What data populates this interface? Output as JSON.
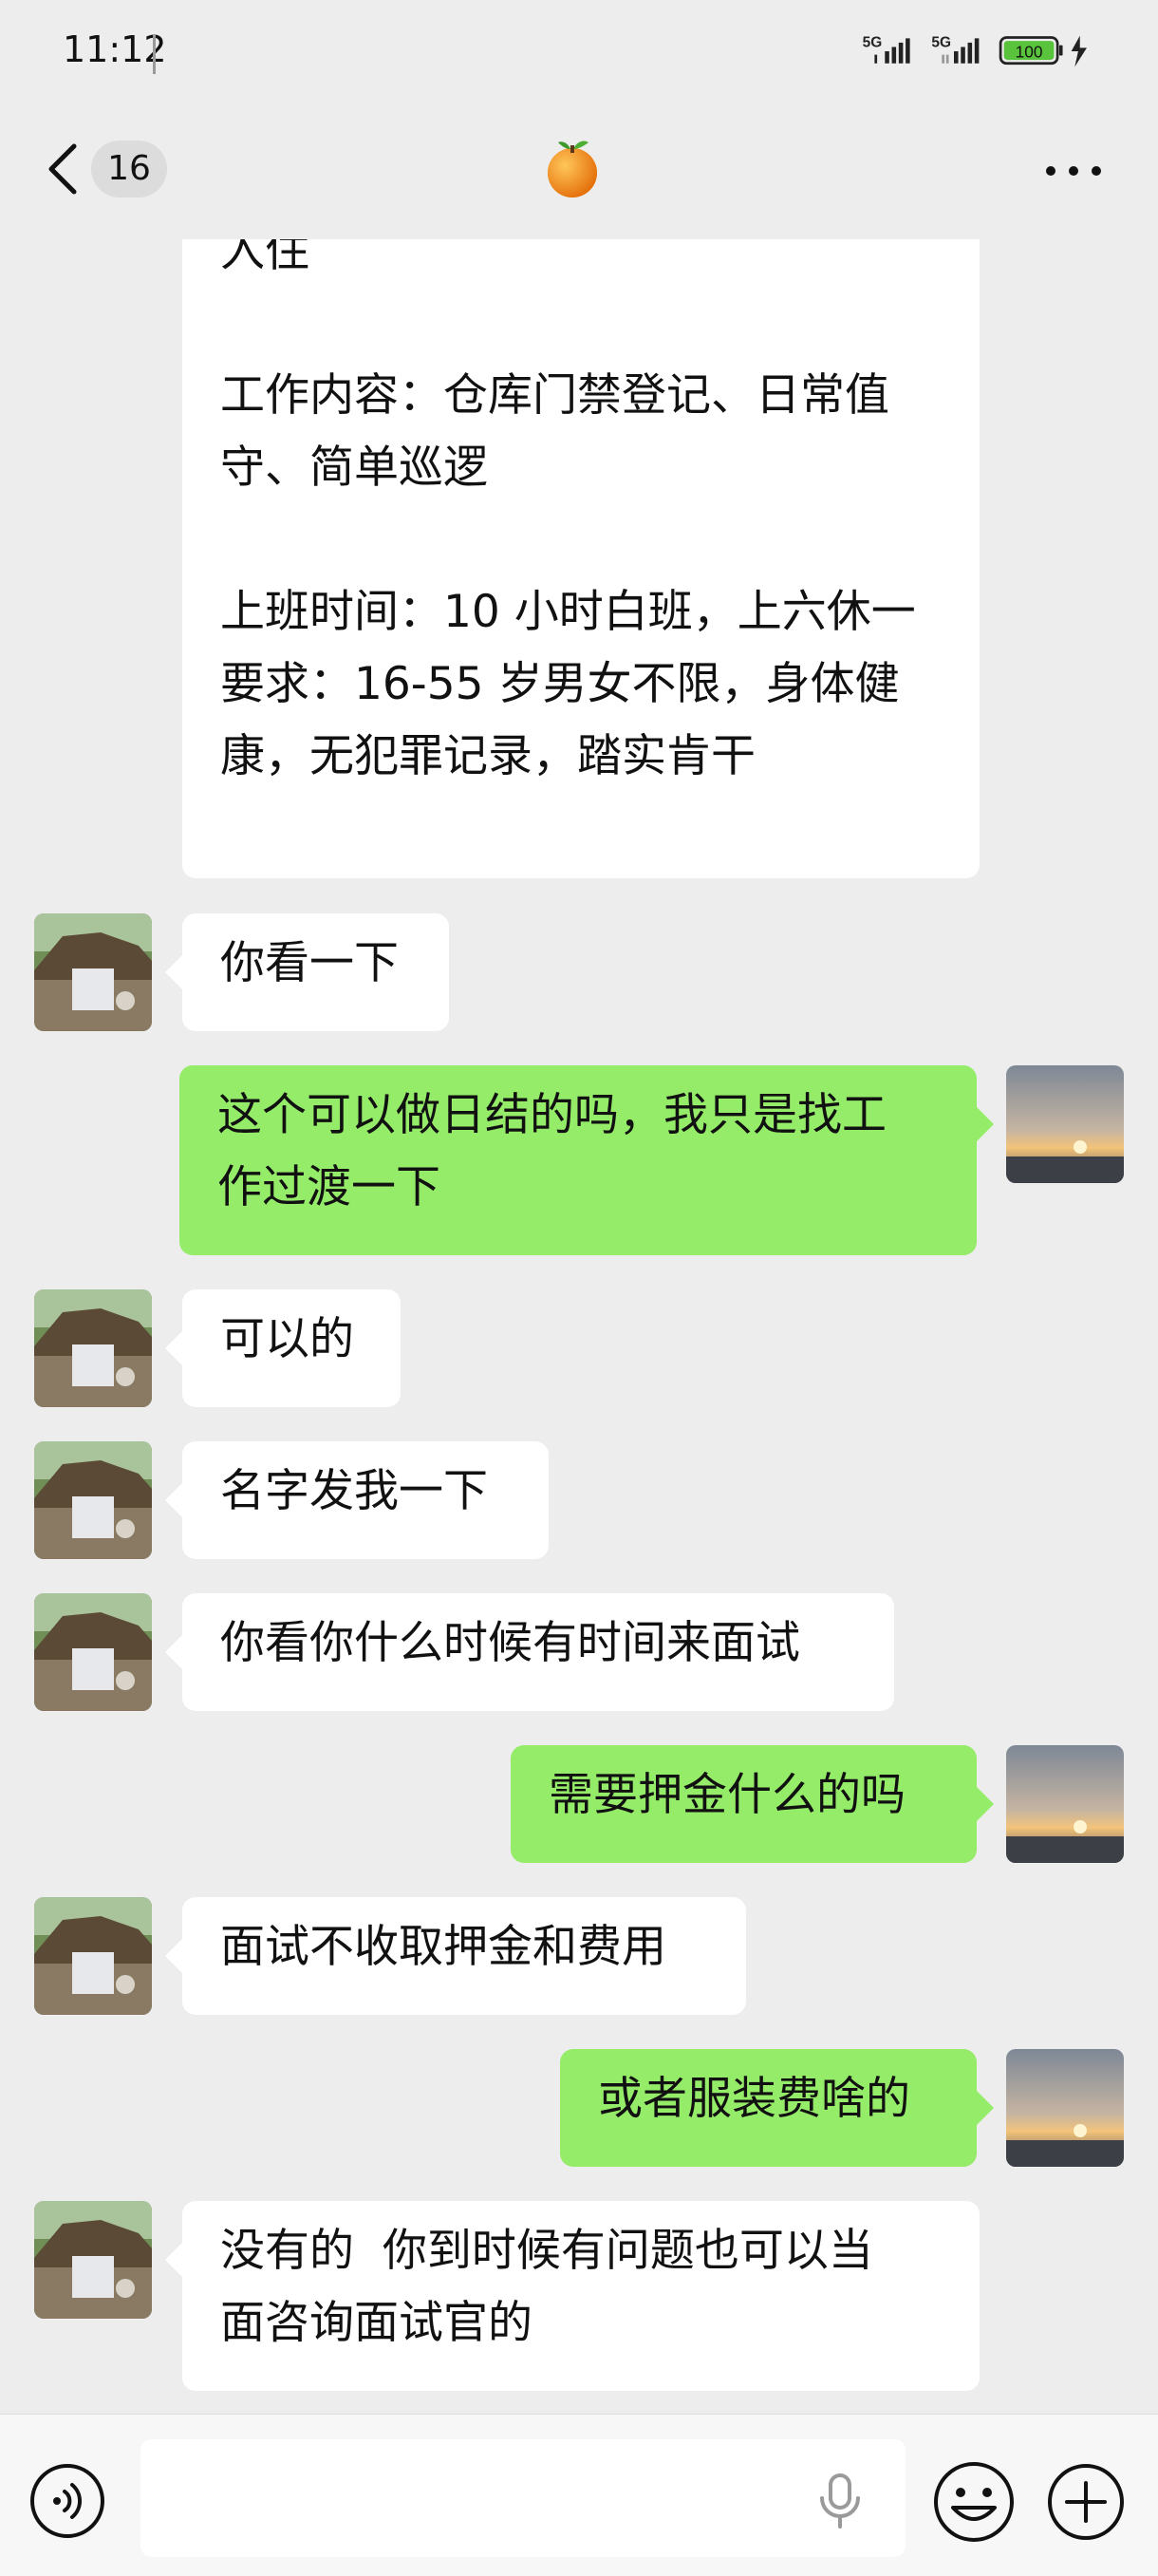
{
  "status_bar": {
    "time": "11:12",
    "sim1": "5G",
    "sim2": "5G",
    "battery": "100"
  },
  "header": {
    "back_count": "16",
    "title_icon": "orange-emoji-avatar",
    "more_icon": "ellipsis-icon"
  },
  "messages": [
    {
      "side": "in",
      "lines": [
        "入住",
        "",
        "工作内容：仓库门禁登记、日常值",
        "守、简单巡逻",
        "",
        "上班时间：10 小时白班，上六休一",
        "要求：16-55 岁男女不限，身体健",
        "康，无犯罪记录，踏实肯干"
      ]
    },
    {
      "side": "in",
      "lines": [
        "你看一下"
      ]
    },
    {
      "side": "out",
      "lines": [
        "这个可以做日结的吗，我只是找工",
        "作过渡一下"
      ]
    },
    {
      "side": "in",
      "lines": [
        "可以的"
      ]
    },
    {
      "side": "in",
      "lines": [
        "名字发我一下"
      ]
    },
    {
      "side": "in",
      "lines": [
        "你看你什么时候有时间来面试"
      ]
    },
    {
      "side": "out",
      "lines": [
        "需要押金什么的吗"
      ]
    },
    {
      "side": "in",
      "lines": [
        "面试不收取押金和费用"
      ]
    },
    {
      "side": "out",
      "lines": [
        "或者服装费啥的"
      ]
    },
    {
      "side": "in",
      "lines": [
        "没有的  你到时候有问题也可以当",
        "面咨询面试官的"
      ]
    }
  ],
  "composer": {
    "input_value": "",
    "voice_icon": "voice-mode-icon",
    "mic_icon": "microphone-icon",
    "emoji_icon": "emoji-icon",
    "plus_icon": "plus-icon"
  },
  "colors": {
    "background": "#ededed",
    "incoming_bubble": "#ffffff",
    "outgoing_bubble": "#95ec69",
    "battery_fill": "#5ac33c"
  }
}
